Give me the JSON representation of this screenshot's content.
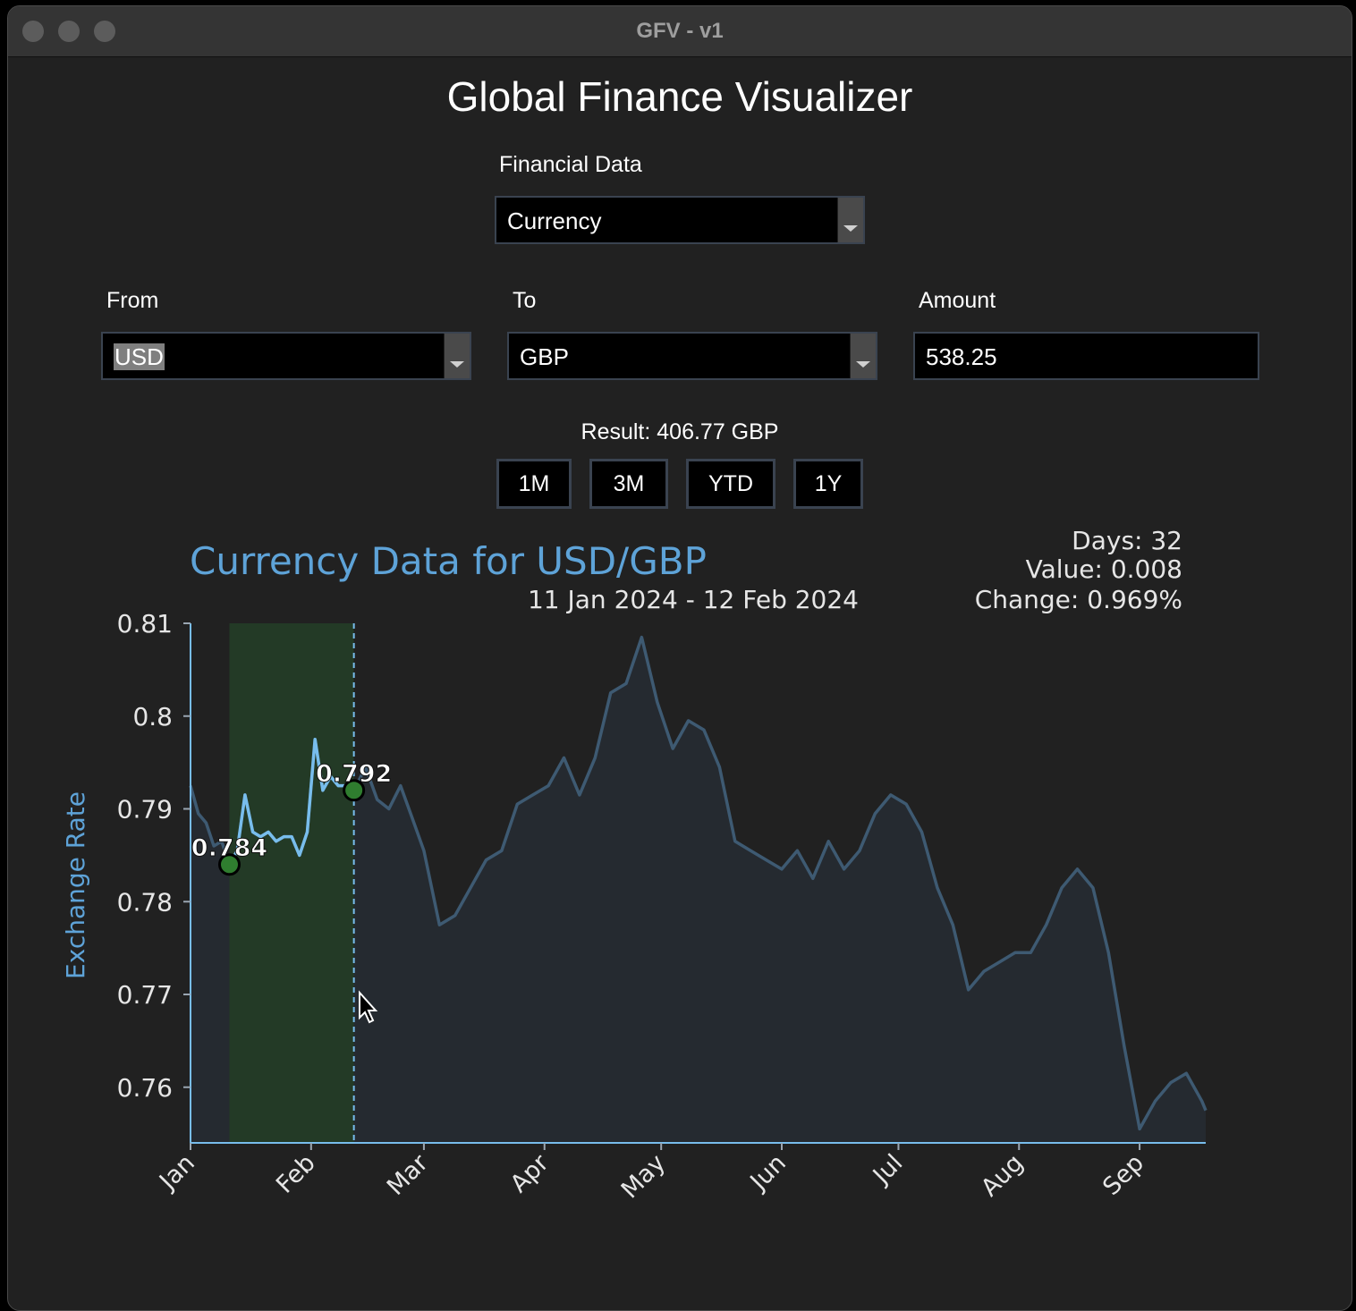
{
  "window": {
    "title": "GFV - v1"
  },
  "app": {
    "title": "Global Finance Visualizer"
  },
  "form": {
    "data_label": "Financial Data",
    "data_value": "Currency",
    "from_label": "From",
    "from_value": "USD",
    "to_label": "To",
    "to_value": "GBP",
    "amount_label": "Amount",
    "amount_value": "538.25"
  },
  "result": "Result: 406.77 GBP",
  "ranges": [
    "1M",
    "3M",
    "YTD",
    "1Y"
  ],
  "chart_data": {
    "type": "line",
    "title": "Currency Data for USD/GBP",
    "subtitle": "11 Jan 2024 - 12 Feb 2024",
    "ylabel": "Exchange Rate",
    "xlabel": "",
    "stats": [
      "Days: 32",
      "Value: 0.008",
      "Change: 0.969%"
    ],
    "ylim": [
      0.754,
      0.81
    ],
    "yticks": [
      0.76,
      0.77,
      0.78,
      0.79,
      0.8,
      0.81
    ],
    "ytick_labels": [
      "0.76",
      "0.77",
      "0.78",
      "0.79",
      "0.8",
      "0.81"
    ],
    "xticks": [
      "2024-01-01",
      "2024-02-01",
      "2024-03-01",
      "2024-04-01",
      "2024-05-01",
      "2024-06-01",
      "2024-07-01",
      "2024-08-01",
      "2024-09-01"
    ],
    "xtick_labels": [
      "Jan",
      "Feb",
      "Mar",
      "Apr",
      "May",
      "Jun",
      "Jul",
      "Aug",
      "Sep"
    ],
    "xlim": [
      "2024-01-01",
      "2024-09-18"
    ],
    "selection": {
      "start": "2024-01-11",
      "end": "2024-02-12"
    },
    "markers": [
      {
        "date": "2024-01-11",
        "value": 0.784,
        "label": "0.784"
      },
      {
        "date": "2024-02-12",
        "value": 0.792,
        "label": "0.792"
      }
    ],
    "colors": {
      "line": "#78bdec",
      "line_dim": "#3e5a72",
      "fill": "#252a30",
      "selection": "#233a26",
      "marker": "#2f7d2f",
      "title": "#5ea3d8"
    },
    "x": [
      "2024-01-01",
      "2024-01-03",
      "2024-01-05",
      "2024-01-07",
      "2024-01-09",
      "2024-01-11",
      "2024-01-13",
      "2024-01-15",
      "2024-01-17",
      "2024-01-19",
      "2024-01-21",
      "2024-01-23",
      "2024-01-25",
      "2024-01-27",
      "2024-01-29",
      "2024-01-31",
      "2024-02-02",
      "2024-02-04",
      "2024-02-06",
      "2024-02-08",
      "2024-02-10",
      "2024-02-12",
      "2024-02-15",
      "2024-02-18",
      "2024-02-21",
      "2024-02-24",
      "2024-02-27",
      "2024-03-01",
      "2024-03-05",
      "2024-03-09",
      "2024-03-13",
      "2024-03-17",
      "2024-03-21",
      "2024-03-25",
      "2024-03-29",
      "2024-04-02",
      "2024-04-06",
      "2024-04-10",
      "2024-04-14",
      "2024-04-18",
      "2024-04-22",
      "2024-04-26",
      "2024-04-30",
      "2024-05-04",
      "2024-05-08",
      "2024-05-12",
      "2024-05-16",
      "2024-05-20",
      "2024-05-24",
      "2024-05-28",
      "2024-06-01",
      "2024-06-05",
      "2024-06-09",
      "2024-06-13",
      "2024-06-17",
      "2024-06-21",
      "2024-06-25",
      "2024-06-29",
      "2024-07-03",
      "2024-07-07",
      "2024-07-11",
      "2024-07-15",
      "2024-07-19",
      "2024-07-23",
      "2024-07-27",
      "2024-07-31",
      "2024-08-04",
      "2024-08-08",
      "2024-08-12",
      "2024-08-16",
      "2024-08-20",
      "2024-08-24",
      "2024-08-28",
      "2024-09-01",
      "2024-09-05",
      "2024-09-09",
      "2024-09-13",
      "2024-09-17",
      "2024-09-18"
    ],
    "values": [
      0.7925,
      0.7895,
      0.7885,
      0.786,
      0.7865,
      0.784,
      0.7855,
      0.7915,
      0.7875,
      0.787,
      0.7875,
      0.7865,
      0.787,
      0.787,
      0.785,
      0.7875,
      0.7975,
      0.792,
      0.7935,
      0.7925,
      0.7925,
      0.792,
      0.7945,
      0.791,
      0.79,
      0.7925,
      0.789,
      0.7855,
      0.7775,
      0.7785,
      0.7815,
      0.7845,
      0.7855,
      0.7905,
      0.7915,
      0.7925,
      0.7955,
      0.7915,
      0.7955,
      0.8025,
      0.8035,
      0.8085,
      0.8015,
      0.7965,
      0.7995,
      0.7985,
      0.7945,
      0.7865,
      0.7855,
      0.7845,
      0.7835,
      0.7855,
      0.7825,
      0.7865,
      0.7835,
      0.7855,
      0.7895,
      0.7915,
      0.7905,
      0.7875,
      0.7815,
      0.7775,
      0.7705,
      0.7725,
      0.7735,
      0.7745,
      0.7745,
      0.7775,
      0.7815,
      0.7835,
      0.7815,
      0.7745,
      0.7645,
      0.7555,
      0.7585,
      0.7605,
      0.7615,
      0.7585,
      0.7575
    ]
  }
}
